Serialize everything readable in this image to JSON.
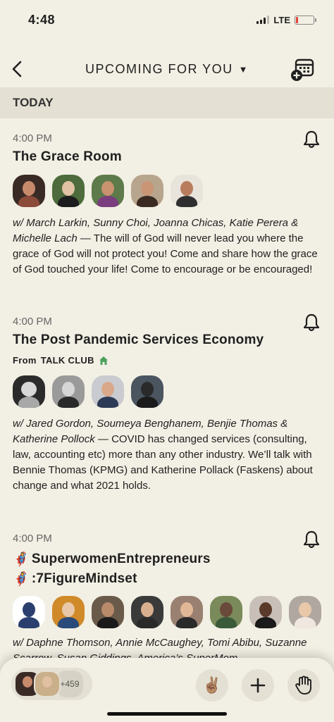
{
  "status": {
    "time": "4:48",
    "network": "LTE",
    "battery_level": 0.12
  },
  "nav": {
    "title": "UPCOMING FOR YOU"
  },
  "section": {
    "label": "TODAY"
  },
  "events": [
    {
      "time": "4:00 PM",
      "title": "The Grace Room",
      "speakers": "w/ March Larkin, Sunny Choi, Joanna Chicas, Katie Perera & Michelle Lach",
      "description": "The will of God will never lead you where the grace of God will not protect you! Come and share how the grace of God touched your life! Come to encourage or be encouraged!"
    },
    {
      "time": "4:00 PM",
      "title": "The Post Pandemic Services Economy",
      "club_prefix": "From",
      "club": "TALK CLUB",
      "speakers": "w/ Jared Gordon, Soumeya Benghanem, Benjie Thomas & Katherine Pollock",
      "description": "COVID has changed services (consulting, law, accounting etc) more than any other industry. We’ll talk with Bennie Thomas (KPMG) and Katherine Pollack (Faskens) about change and what 2021 holds."
    },
    {
      "time": "4:00 PM",
      "title_line1": "SuperwomenEntrepreneurs",
      "title_line2": ":7FigureMindset",
      "title_emoji": "🦸‍♀️",
      "speakers": "w/ Daphne Thomson, Annie McCaughey, Tomi Abibu, Suzanne Scarrow, Susan Giddings, America’s SuperMom"
    }
  ],
  "bottom": {
    "listener_count": "+459",
    "raise_hand_emoji": "✌🏽"
  }
}
